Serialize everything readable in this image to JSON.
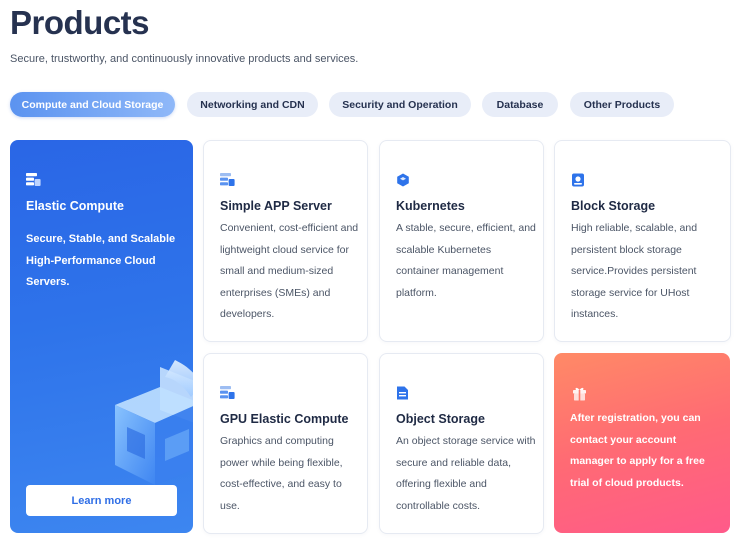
{
  "header": {
    "title": "Products",
    "subtitle": "Secure, trustworthy, and continuously innovative products and services."
  },
  "tabs": [
    {
      "label": "Compute and Cloud Storage",
      "active": true
    },
    {
      "label": "Networking and CDN",
      "active": false
    },
    {
      "label": "Security and Operation",
      "active": false
    },
    {
      "label": "Database",
      "active": false
    },
    {
      "label": "Other Products",
      "active": false
    }
  ],
  "hero": {
    "title": "Elastic Compute",
    "description": "Secure, Stable, and Scalable High-Performance Cloud Servers.",
    "button_label": "Learn more",
    "icon": "server-icon"
  },
  "cards": [
    {
      "title": "Simple APP Server",
      "description": "Convenient, cost-efficient and lightweight cloud service for small and medium-sized enterprises (SMEs) and developers.",
      "icon": "server-icon"
    },
    {
      "title": "Kubernetes",
      "description": "A stable, secure, efficient, and scalable Kubernetes container management platform.",
      "icon": "hexagon-icon"
    },
    {
      "title": "Block Storage",
      "description": "High reliable, scalable, and persistent block storage service.Provides persistent storage service for UHost instances.",
      "icon": "disk-icon"
    },
    {
      "title": "GPU Elastic Compute",
      "description": "Graphics and computing power while being flexible, cost-effective, and easy to use.",
      "icon": "server-icon"
    },
    {
      "title": "Object Storage",
      "description": "An object storage service with secure and reliable data, offering flexible and controllable costs.",
      "icon": "document-icon"
    }
  ],
  "promo": {
    "text": "After registration, you can contact your account manager to apply for a free trial of cloud products.",
    "icon": "gift-icon"
  },
  "colors": {
    "accent": "#2e73ea",
    "tab_bg": "#e8edf8",
    "heading": "#263250",
    "promo_start": "#ff8a66",
    "promo_end": "#ff5a8a"
  }
}
